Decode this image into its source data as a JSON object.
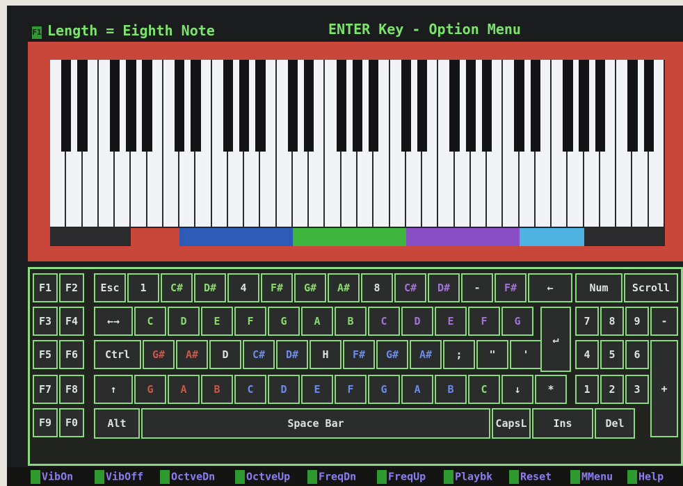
{
  "title_bar": {
    "fkey_glyph": "F1",
    "length_label": "Length = Eighth  Note",
    "menu_hint": "ENTER Key - Option Menu"
  },
  "piano": {
    "white_keys_count": 38,
    "octave_colors": [
      "#2b2b2e",
      "#c8463a",
      "#2e5bb5",
      "#3fb53f",
      "#8a4fc4",
      "#4fb2e0",
      "#2b2b2e"
    ]
  },
  "keyboard": {
    "function_keys": [
      "F1",
      "F2",
      "F3",
      "F4",
      "F5",
      "F6",
      "F7",
      "F8",
      "F9",
      "F0"
    ],
    "row1": [
      {
        "label": "Esc",
        "color": "white"
      },
      {
        "label": "1",
        "color": "white"
      },
      {
        "label": "C#",
        "color": "green"
      },
      {
        "label": "D#",
        "color": "green"
      },
      {
        "label": "4",
        "color": "white"
      },
      {
        "label": "F#",
        "color": "green"
      },
      {
        "label": "G#",
        "color": "green"
      },
      {
        "label": "A#",
        "color": "green"
      },
      {
        "label": "8",
        "color": "white"
      },
      {
        "label": "C#",
        "color": "purple"
      },
      {
        "label": "D#",
        "color": "purple"
      },
      {
        "label": "-",
        "color": "white"
      },
      {
        "label": "F#",
        "color": "purple"
      },
      {
        "label": "←",
        "color": "white"
      }
    ],
    "row2": [
      {
        "label": "←→",
        "color": "white"
      },
      {
        "label": "C",
        "color": "green"
      },
      {
        "label": "D",
        "color": "green"
      },
      {
        "label": "E",
        "color": "green"
      },
      {
        "label": "F",
        "color": "green"
      },
      {
        "label": "G",
        "color": "green"
      },
      {
        "label": "A",
        "color": "green"
      },
      {
        "label": "B",
        "color": "green"
      },
      {
        "label": "C",
        "color": "purple"
      },
      {
        "label": "D",
        "color": "purple"
      },
      {
        "label": "E",
        "color": "purple"
      },
      {
        "label": "F",
        "color": "purple"
      },
      {
        "label": "G",
        "color": "purple"
      }
    ],
    "enter_glyph": "↵",
    "row3": [
      {
        "label": "Ctrl",
        "color": "white"
      },
      {
        "label": "G#",
        "color": "red"
      },
      {
        "label": "A#",
        "color": "red"
      },
      {
        "label": "D",
        "color": "white"
      },
      {
        "label": "C#",
        "color": "blue"
      },
      {
        "label": "D#",
        "color": "blue"
      },
      {
        "label": "H",
        "color": "white"
      },
      {
        "label": "F#",
        "color": "blue"
      },
      {
        "label": "G#",
        "color": "blue"
      },
      {
        "label": "A#",
        "color": "blue"
      },
      {
        "label": ";",
        "color": "white"
      },
      {
        "label": "\"",
        "color": "white"
      },
      {
        "label": "'",
        "color": "white"
      }
    ],
    "row4": [
      {
        "label": "↑",
        "color": "white"
      },
      {
        "label": "G",
        "color": "red"
      },
      {
        "label": "A",
        "color": "red"
      },
      {
        "label": "B",
        "color": "red"
      },
      {
        "label": "C",
        "color": "blue"
      },
      {
        "label": "D",
        "color": "blue"
      },
      {
        "label": "E",
        "color": "blue"
      },
      {
        "label": "F",
        "color": "blue"
      },
      {
        "label": "G",
        "color": "blue"
      },
      {
        "label": "A",
        "color": "blue"
      },
      {
        "label": "B",
        "color": "blue"
      },
      {
        "label": "C",
        "color": "green"
      },
      {
        "label": "↓",
        "color": "white"
      },
      {
        "label": "*",
        "color": "white"
      }
    ],
    "row5": {
      "alt": "Alt",
      "space": "Space Bar",
      "capsl": "CapsL",
      "ins": "Ins",
      "del": "Del"
    },
    "numpad": {
      "num": "Num",
      "scroll": "Scroll",
      "keys": [
        "7",
        "8",
        "9",
        "-",
        "4",
        "5",
        "6",
        "1",
        "2",
        "3",
        "+"
      ]
    }
  },
  "status_bar": [
    {
      "label": "VibOn"
    },
    {
      "label": "VibOff"
    },
    {
      "label": "OctveDn"
    },
    {
      "label": "OctveUp"
    },
    {
      "label": "FreqDn"
    },
    {
      "label": "FreqUp"
    },
    {
      "label": "Playbk"
    },
    {
      "label": "Reset"
    },
    {
      "label": "MMenu"
    },
    {
      "label": "Help"
    }
  ]
}
